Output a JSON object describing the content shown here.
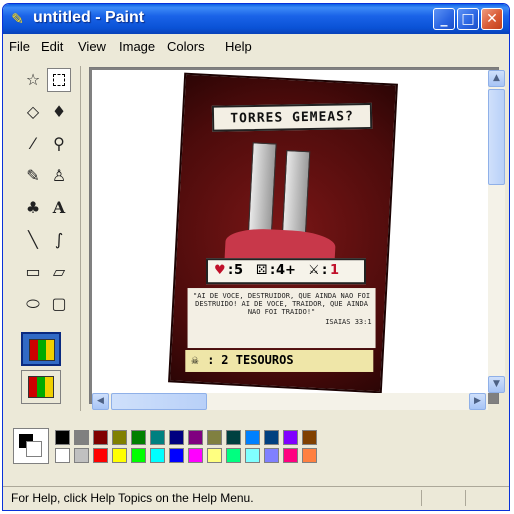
{
  "window": {
    "title": "untitled - Paint",
    "minimize_label": "_",
    "maximize_label": "□",
    "close_label": "✕"
  },
  "menu": {
    "items": [
      "File",
      "Edit",
      "View",
      "Image",
      "Colors",
      "Help"
    ]
  },
  "tools": [
    "free-form-select-icon",
    "select-icon",
    "eraser-icon",
    "fill-icon",
    "pick-color-icon",
    "magnifier-icon",
    "pencil-icon",
    "brush-icon",
    "airbrush-icon",
    "text-icon",
    "line-icon",
    "curve-icon",
    "rectangle-icon",
    "polygon-icon",
    "ellipse-icon",
    "rounded-rectangle-icon"
  ],
  "canvas_image": {
    "card_title": "TORRES GEMEAS?",
    "stat_health": "5",
    "stat_dice": "4+",
    "stat_attack": "1",
    "quote": "\"AI DE VOCE, DESTRUIDOR, QUE AINDA NAO FOI DESTRUIDO! AI DE VOCE, TRAIDOR, QUE AINDA NAO FOI TRAIDO!\"",
    "quote_ref": "ISAIAS 33:1",
    "reward": "2 TESOUROS"
  },
  "palette": {
    "row1": [
      "#000000",
      "#808080",
      "#800000",
      "#808000",
      "#008000",
      "#008080",
      "#000080",
      "#800080",
      "#808040",
      "#004040",
      "#0080ff",
      "#004080",
      "#8000ff",
      "#804000"
    ],
    "row2": [
      "#ffffff",
      "#c0c0c0",
      "#ff0000",
      "#ffff00",
      "#00ff00",
      "#00ffff",
      "#0000ff",
      "#ff00ff",
      "#ffff80",
      "#00ff80",
      "#80ffff",
      "#8080ff",
      "#ff0080",
      "#ff8040"
    ]
  },
  "status": {
    "help_text": "For Help, click Help Topics on the Help Menu."
  }
}
